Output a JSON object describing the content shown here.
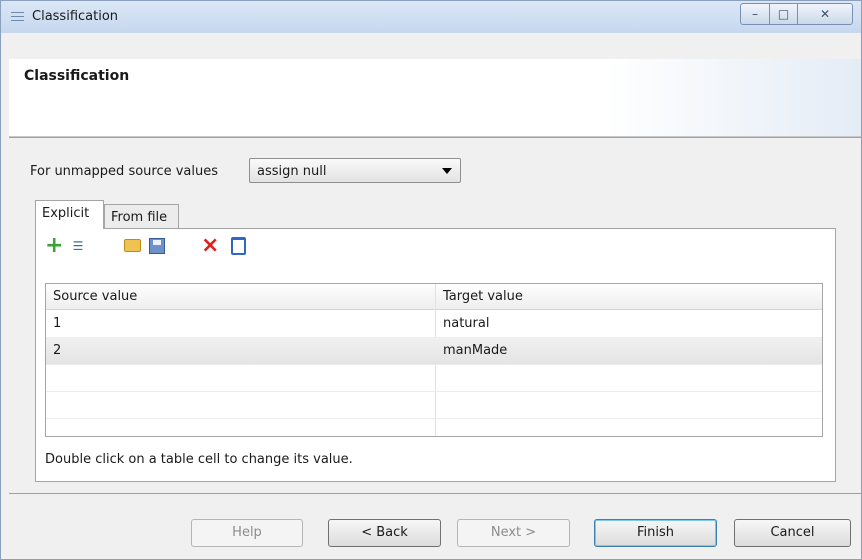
{
  "window": {
    "title": "Classification",
    "controls": {
      "minimize": "–",
      "maximize": "□",
      "close": "✕"
    }
  },
  "header": {
    "title": "Classification"
  },
  "unmapped": {
    "label": "For unmapped source values",
    "selected": "assign null"
  },
  "tabs": [
    {
      "label": "Explicit",
      "active": true
    },
    {
      "label": "From file",
      "active": false
    }
  ],
  "toolbar": {
    "icons": [
      "add-icon",
      "list-icon",
      "open-folder-icon",
      "save-icon",
      "delete-icon",
      "trash-icon"
    ]
  },
  "table": {
    "columns": [
      "Source value",
      "Target value"
    ],
    "rows": [
      {
        "source": "1",
        "target": "natural"
      },
      {
        "source": "2",
        "target": "manMade"
      }
    ]
  },
  "hint": "Double click on a table cell to change its value.",
  "buttons": {
    "help": "Help",
    "back": "< Back",
    "next": "Next >",
    "finish": "Finish",
    "cancel": "Cancel"
  },
  "colors": {
    "title_bar": "#c6d7ee",
    "finish_focus": "#3c7fb1",
    "add_icon": "#3aa336",
    "delete_icon": "#e11d1d"
  }
}
